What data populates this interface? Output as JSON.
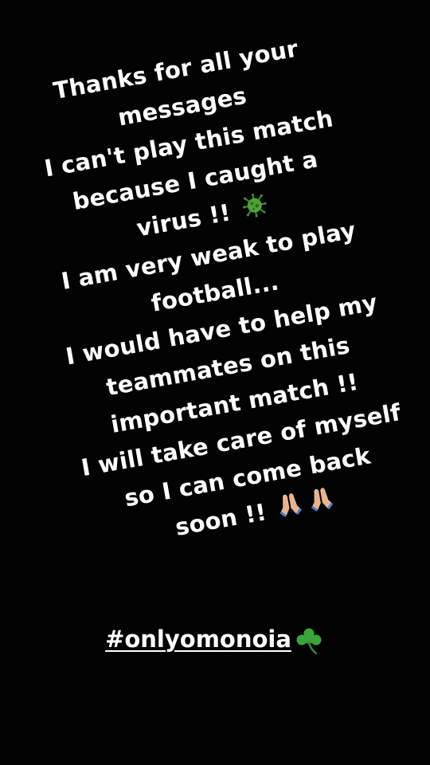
{
  "message": {
    "lines": [
      "Thanks for all your",
      "messages",
      "I can't play this match",
      "because I caught a",
      "virus !!",
      "I am very weak to play",
      "football...",
      "I would have to help my",
      "teammates on this",
      "important match !!",
      "I will take care of myself",
      "so I can come back",
      "soon !!"
    ]
  },
  "icons": {
    "virus": "virus-icon",
    "prayer": "folded-hands-icon",
    "clover": "shamrock-icon"
  },
  "hashtag": "#onlyomonoia",
  "colors": {
    "background": "#030303",
    "text": "#ffffff",
    "virus": "#3f8f2a",
    "clover": "#3aa63a",
    "skin": "#e8b48e",
    "sleeve": "#4a7fd0"
  }
}
